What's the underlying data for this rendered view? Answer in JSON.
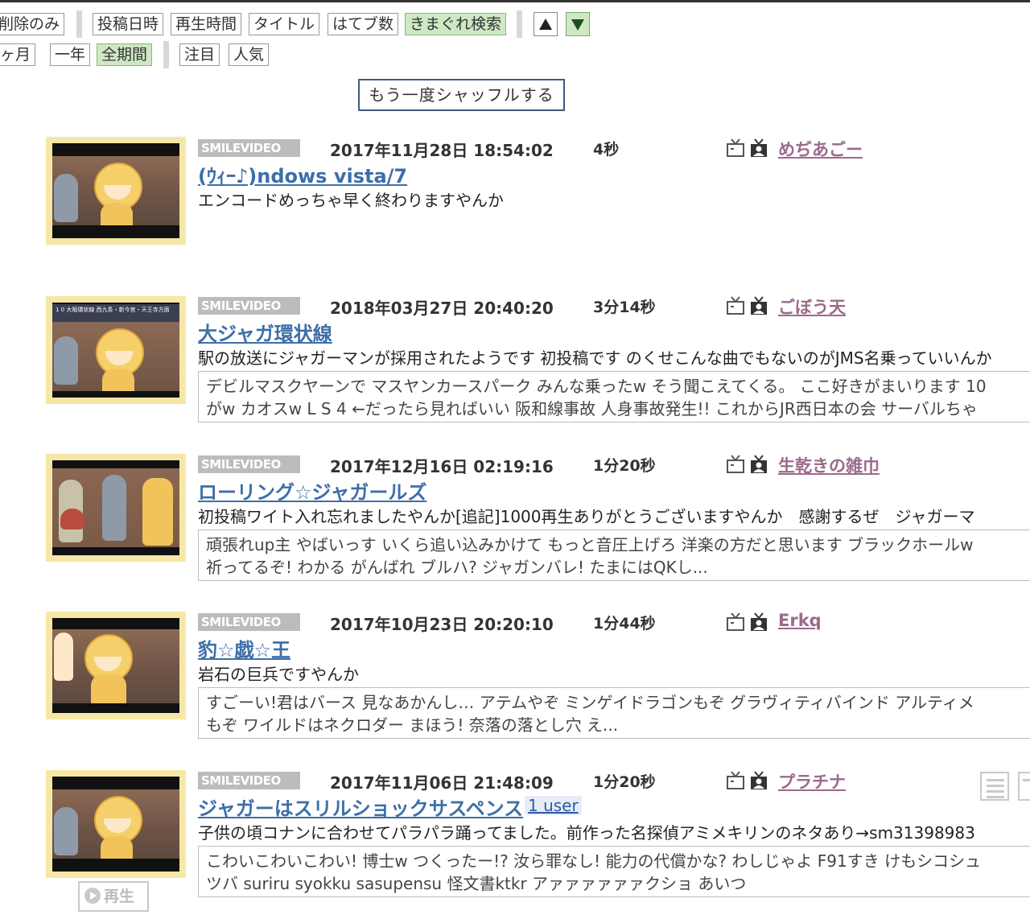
{
  "toolbar": {
    "row1": [
      {
        "label": "削除のみ",
        "active": false
      },
      {
        "label": "投稿日時",
        "active": false
      },
      {
        "label": "再生時間",
        "active": false
      },
      {
        "label": "タイトル",
        "active": false
      },
      {
        "label": "はてブ数",
        "active": false
      },
      {
        "label": "きまぐれ検索",
        "active": true
      }
    ],
    "sort_up": {
      "icon": "triangle-up-icon",
      "active": false
    },
    "sort_down": {
      "icon": "triangle-down-icon",
      "active": true
    },
    "row2": [
      {
        "label": "ヶ月",
        "active": false
      },
      {
        "label": "一年",
        "active": false
      },
      {
        "label": "全期間",
        "active": true
      },
      {
        "label": "注目",
        "active": false
      },
      {
        "label": "人気",
        "active": false
      }
    ],
    "shuffle_label": "もう一度シャッフルする"
  },
  "videos": [
    {
      "source": "SMILEVIDEO",
      "date": "2017年11月28日 18:54:02",
      "duration": "4秒",
      "user": "めぢあごー",
      "title": "(ｳｨｰ♪)ndows vista/7",
      "description": "エンコードめっちゃ早く終わりますやんか",
      "comments": []
    },
    {
      "source": "SMILEVIDEO",
      "date": "2018年03月27日 20:40:20",
      "duration": "3分14秒",
      "user": "ごぼう天",
      "title": "大ジャガ環状線",
      "description": "駅の放送にジャガーマンが採用されたようです 初投稿です のくせこんな曲でもないのがJMS名乗っていいんか",
      "comments": [
        "デビルマスクヤーンで マスヤンカースパーク みんな乗ったw そう聞こえてくる。 ここ好きがまいります 10",
        "がw カオスw L S 4 ←だったら見ればいい 阪和線事故 人身事故発生!! これからJR西日本の会 サーバルちゃ"
      ],
      "thumb_caption": "1 0 大阪環状線 西九条・新今宮・天王寺方面"
    },
    {
      "source": "SMILEVIDEO",
      "date": "2017年12月16日 02:19:16",
      "duration": "1分20秒",
      "user": "生乾きの雑巾",
      "title": "ローリング☆ジャガールズ",
      "description": "初投稿ワイト入れ忘れましたやんか[追記]1000再生ありがとうございますやんか　感謝するぜ　ジャガーマ",
      "comments": [
        "頑張れup主 やばいっす いくら追い込みかけて もっと音圧上げろ 洋楽の方だと思います ブラックホールw",
        "祈ってるぞ! わかる がんばれ ブルハ? ジャガンバレ! たまにはQKし..."
      ]
    },
    {
      "source": "SMILEVIDEO",
      "date": "2017年10月23日 20:20:10",
      "duration": "1分44秒",
      "user": "Erkq",
      "title": "豹☆戯☆王",
      "description": "岩石の巨兵ですやんか",
      "comments": [
        "すごーい!君はバース 見なあかんし… アテムやぞ ミンゲイドラゴンもぞ グラヴィティバインド アルティメ",
        "もぞ ワイルドはネクロダー まほう! 奈落の落とし穴 え..."
      ]
    },
    {
      "source": "SMILEVIDEO",
      "date": "2017年11月06日 21:48:09",
      "duration": "1分20秒",
      "user": "プラチナ",
      "title": "ジャガーはスリルショックサスペンス",
      "user_count": "1 user",
      "description": "子供の頃コナンに合わせてパラパラ踊ってました。前作った名探偵アミメキリンのネタあり→sm31398983",
      "comments": [
        "こわいこわいこわい! 博士w つくったー!? 汝ら罪なし! 能力の代償かな? わしじゃよ F91すき けもシコシュ",
        "ツバ suriru syokku sasupensu 怪文書ktkr アァァァァァァクショ あいつ"
      ],
      "play_label": "再生"
    }
  ]
}
